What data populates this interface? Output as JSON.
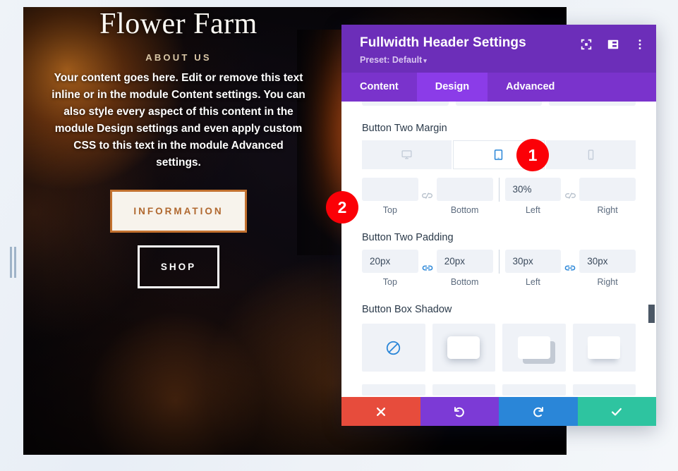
{
  "site_preview": {
    "title": "Flower Farm",
    "eyebrow": "ABOUT US",
    "body": "Your content goes here. Edit or remove this text inline or in the module Content settings. You can also style every aspect of this content in the module Design settings and even apply custom CSS to this text in the module Advanced settings.",
    "button_one_label": "INFORMATION",
    "button_two_label": "SHOP"
  },
  "modal": {
    "title": "Fullwidth Header Settings",
    "preset_label": "Preset: Default",
    "preset_caret": "▾",
    "header_icons": [
      {
        "name": "focus-mode-icon"
      },
      {
        "name": "panel-layout-icon"
      },
      {
        "name": "more-options-icon"
      }
    ],
    "tabs": [
      {
        "label": "Content",
        "active": false
      },
      {
        "label": "Design",
        "active": true
      },
      {
        "label": "Advanced",
        "active": false
      }
    ],
    "sections": {
      "button_two_margin": {
        "label": "Button Two Margin",
        "devices": [
          {
            "name": "desktop",
            "active": false
          },
          {
            "name": "tablet",
            "active": true
          },
          {
            "name": "phone",
            "active": false
          }
        ],
        "fields": [
          {
            "caption": "Top",
            "value": "",
            "placeholder": ""
          },
          {
            "caption": "Bottom",
            "value": "",
            "placeholder": ""
          },
          {
            "caption": "Left",
            "value": "30%",
            "placeholder": ""
          },
          {
            "caption": "Right",
            "value": "",
            "placeholder": ""
          }
        ],
        "link_state": "unlinked"
      },
      "button_two_padding": {
        "label": "Button Two Padding",
        "fields": [
          {
            "caption": "Top",
            "value": "20px",
            "placeholder": ""
          },
          {
            "caption": "Bottom",
            "value": "20px",
            "placeholder": ""
          },
          {
            "caption": "Left",
            "value": "30px",
            "placeholder": ""
          },
          {
            "caption": "Right",
            "value": "30px",
            "placeholder": ""
          }
        ],
        "link_state": "linked"
      },
      "button_box_shadow": {
        "label": "Button Box Shadow",
        "options": [
          {
            "name": "no-shadow",
            "selected": true
          },
          {
            "name": "shadow-soft-outer"
          },
          {
            "name": "shadow-hard-offset"
          },
          {
            "name": "shadow-bottom-drop"
          }
        ]
      }
    },
    "footer": [
      {
        "name": "cancel-button",
        "icon": "close-icon"
      },
      {
        "name": "undo-button",
        "icon": "undo-icon"
      },
      {
        "name": "redo-button",
        "icon": "redo-icon"
      },
      {
        "name": "save-button",
        "icon": "check-icon"
      }
    ]
  },
  "badges": [
    {
      "id": "1",
      "label": "1"
    },
    {
      "id": "2",
      "label": "2"
    }
  ],
  "colors": {
    "modal_header": "#6C2EB9",
    "tab_bar": "#7A33CC",
    "tab_active": "#8B3CE8",
    "badge_red": "#FB0007",
    "cancel": "#E74C3C",
    "undo": "#7C3AD6",
    "redo": "#2A86D8",
    "save": "#2EC4A0",
    "link_active": "#2a86d8",
    "link_inactive": "#b3bdc9"
  }
}
